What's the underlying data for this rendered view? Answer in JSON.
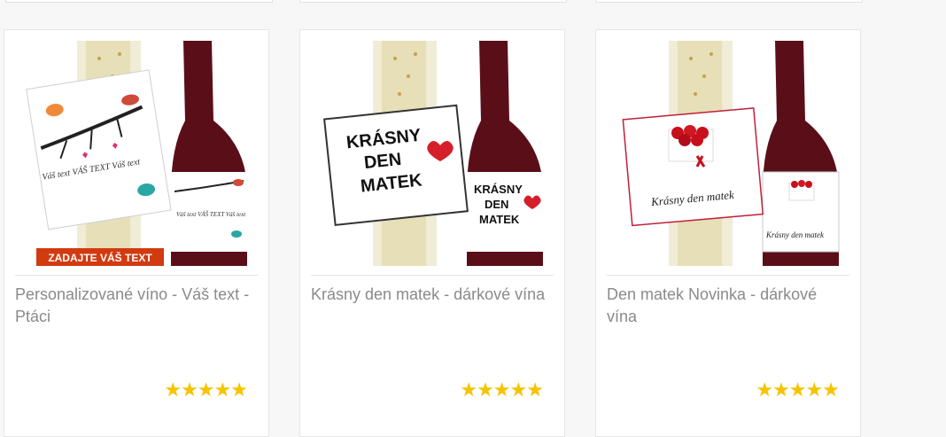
{
  "products": [
    {
      "title": "Personalizované víno - Váš text - Ptáci",
      "label_big": "Váš text VÁŠ TEXT Váš text",
      "label_small": "Váš text VÁŠ TEXT Váš text",
      "badge": "ZADAJTE VÁŠ TEXT",
      "rating_stars": 5
    },
    {
      "title": "Krásny den matek - dárkové vína",
      "label_big_line1": "KRÁSNY",
      "label_big_line2": "DEN",
      "label_big_line3": "MATEK",
      "label_small_line1": "KRÁSNY",
      "label_small_line2": "DEN",
      "label_small_line3": "MATEK",
      "rating_stars": 5
    },
    {
      "title": "Den matek Novinka - dárkové vína",
      "label_big": "Krásny den matek",
      "label_small": "Krásny den matek",
      "rating_stars": 5
    }
  ],
  "colors": {
    "star": "#f7c300",
    "title": "#8a8a8a",
    "badge": "#d23a10"
  }
}
